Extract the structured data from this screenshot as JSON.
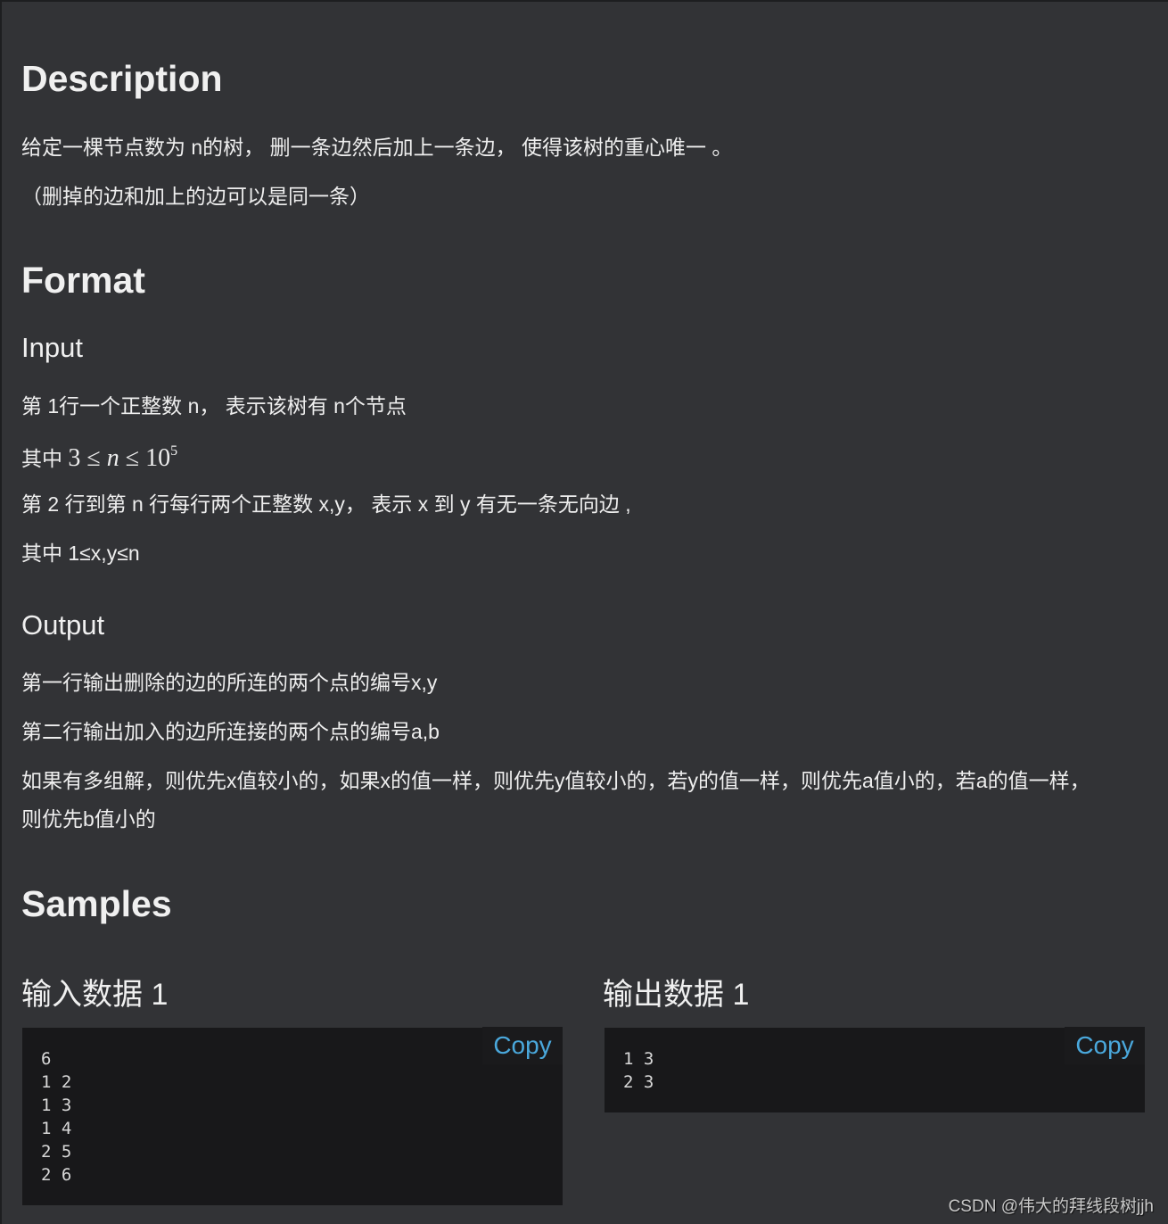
{
  "description": {
    "heading": "Description",
    "paragraphs": [
      "给定一棵节点数为 n的树， 删一条边然后加上一条边， 使得该树的重心唯一 。",
      "（删掉的边和加上的边可以是同一条）"
    ]
  },
  "format": {
    "heading": "Format",
    "input": {
      "heading": "Input",
      "line1": "第 1行一个正整数 n， 表示该树有 n个节点",
      "line2_prefix": "其中 ",
      "line2_math": {
        "lower": "3",
        "le1": "≤",
        "var": "n",
        "le2": "≤",
        "base": "10",
        "exponent": "5"
      },
      "line3": "第 2 行到第 n 行每行两个正整数 x,y， 表示 x 到 y 有无一条无向边 ,",
      "line4": "其中 1≤x,y≤n"
    },
    "output": {
      "heading": "Output",
      "line1": "第一行输出删除的边的所连的两个点的编号x,y",
      "line2": "第二行输出加入的边所连接的两个点的编号a,b",
      "line3a": "如果有多组解，则优先x值较小的，如果x的值一样，则优先y值较小的，若y的值一样，则优先a值小的，若a的值一样，",
      "line3b": "则优先b值小的"
    }
  },
  "samples": {
    "heading": "Samples",
    "input": {
      "title": "输入数据 1",
      "content": "6\n1 2\n1 3\n1 4\n2 5\n2 6",
      "copy_label": "Copy"
    },
    "output": {
      "title": "输出数据 1",
      "content": "1 3\n2 3",
      "copy_label": "Copy"
    }
  },
  "watermark": "CSDN @伟大的拜线段树jjh",
  "colors": {
    "background": "#323336",
    "code_background": "#18181a",
    "copy_link": "#4aa8dc",
    "text": "#eeeeee"
  }
}
